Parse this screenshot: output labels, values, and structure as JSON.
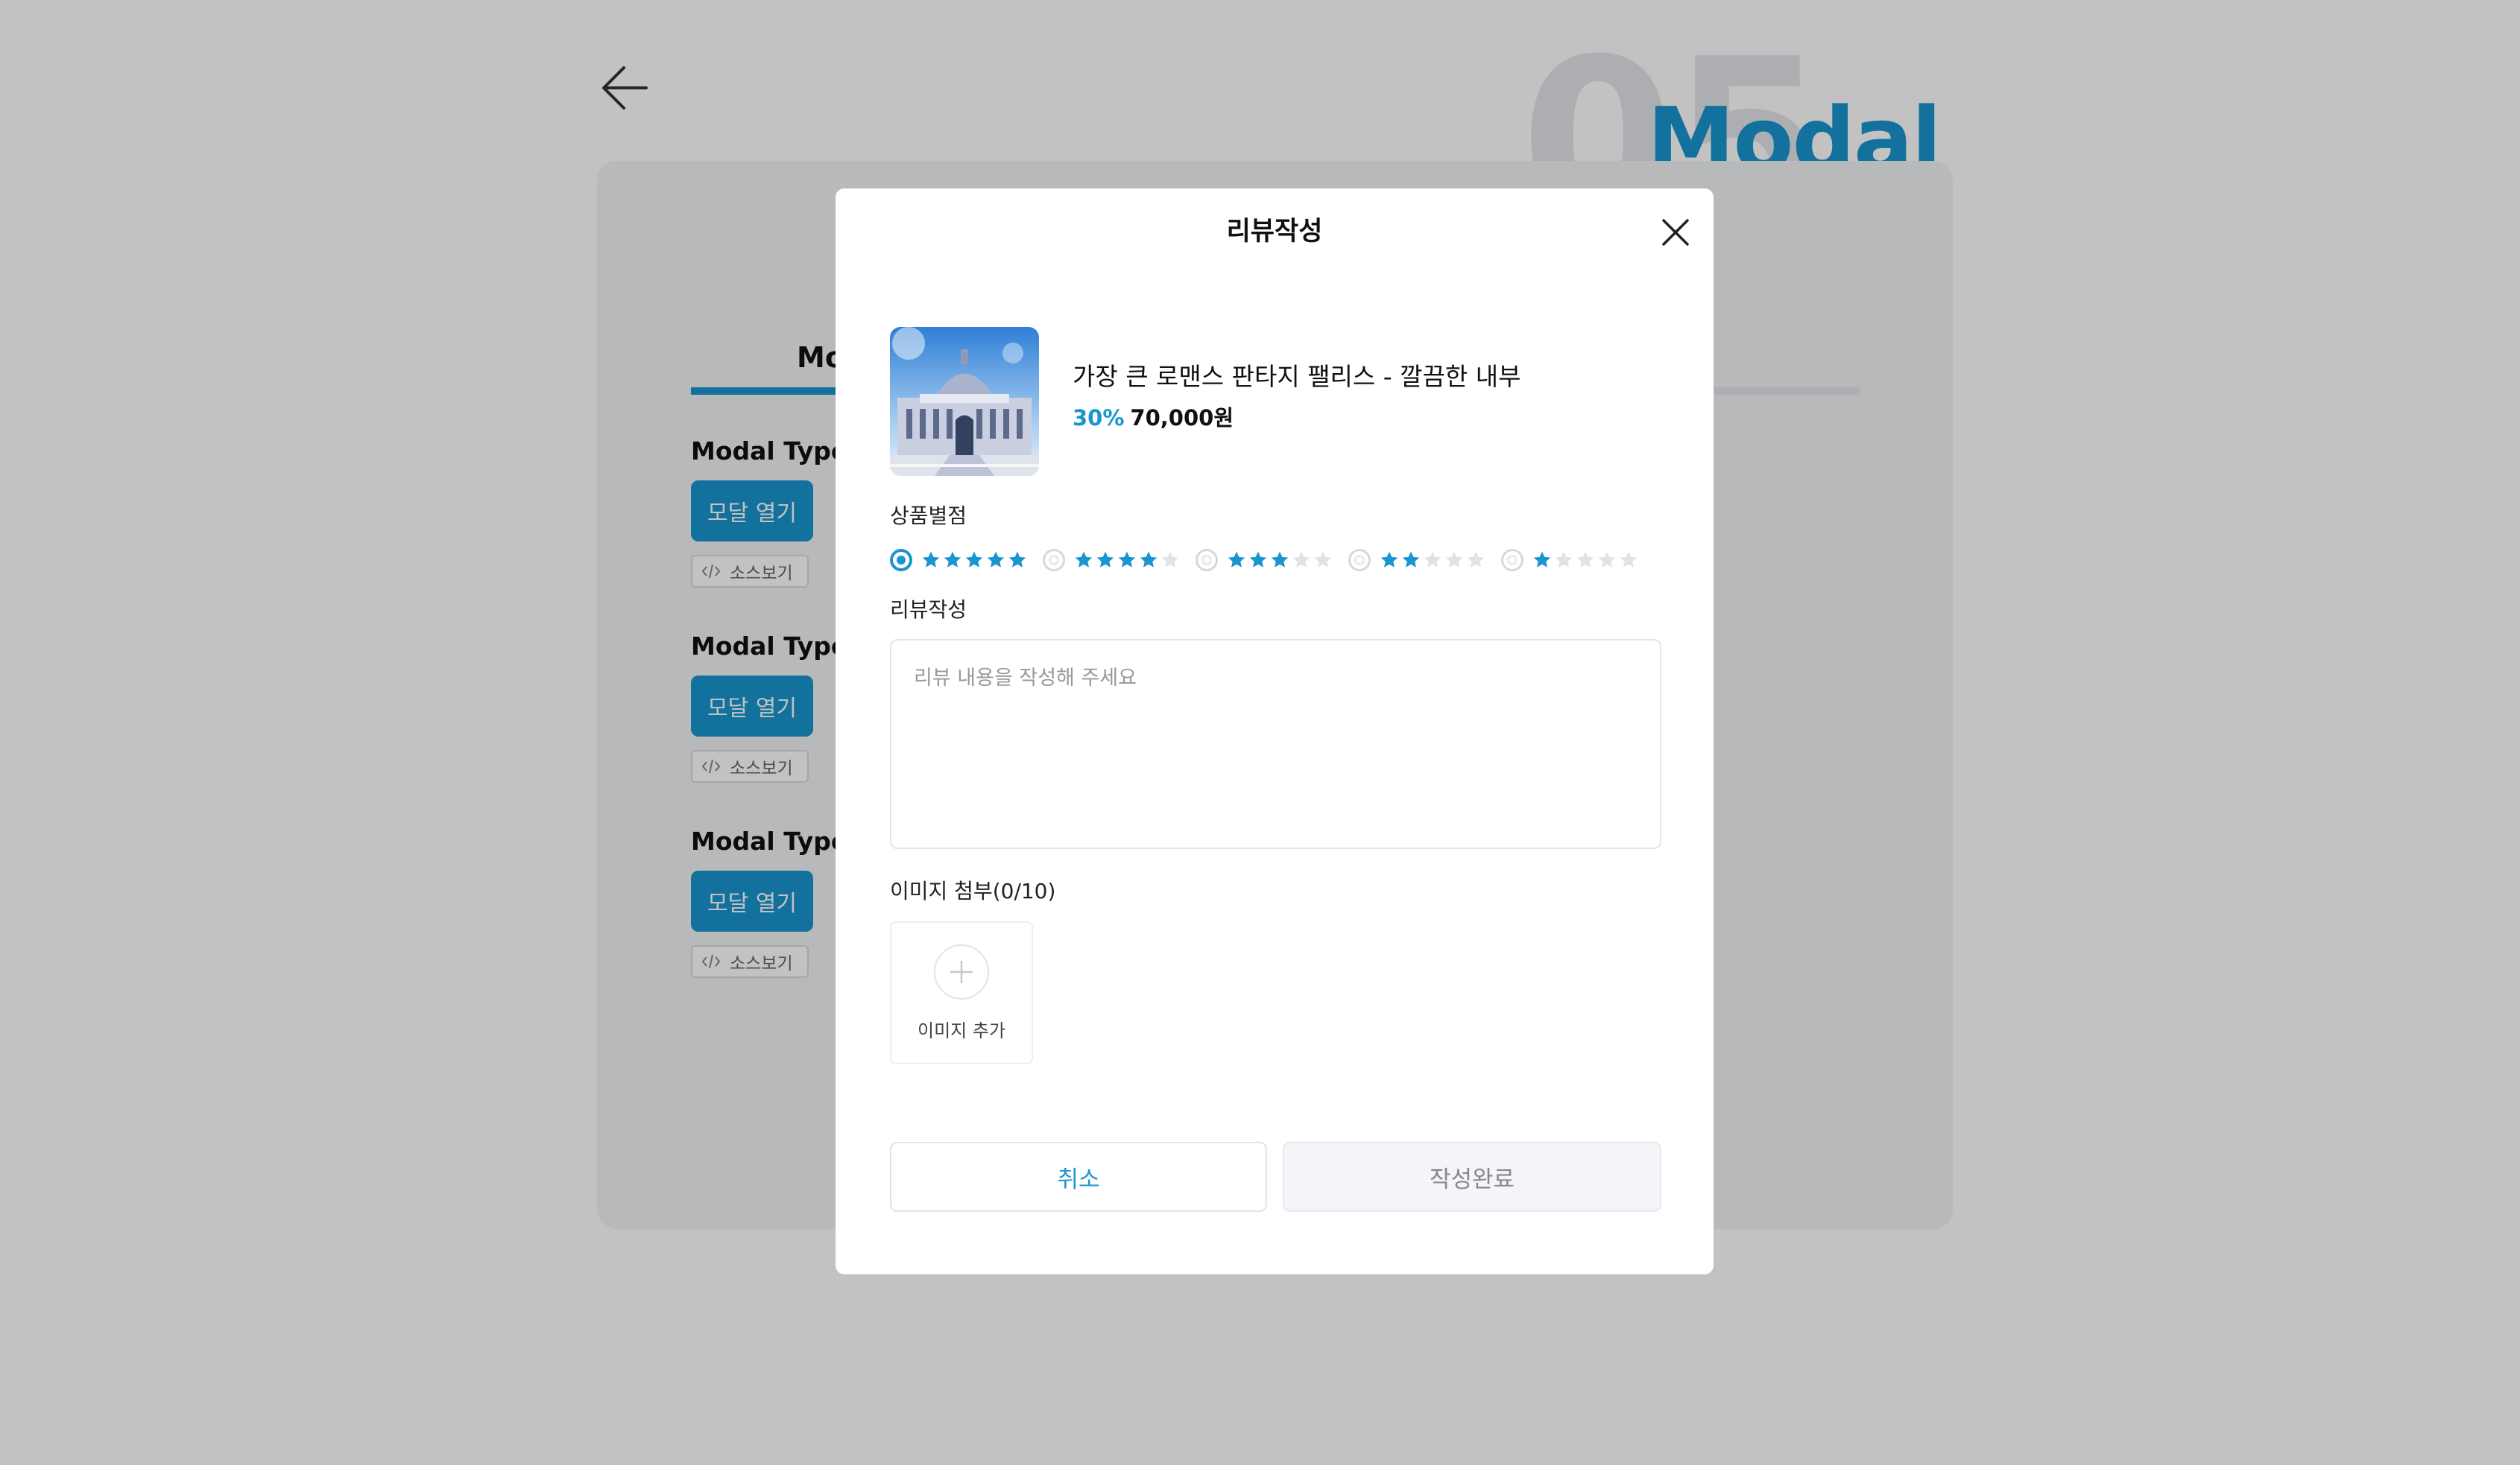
{
  "page": {
    "number": "05",
    "title": "Modal",
    "tab_active": "Mo"
  },
  "sections": [
    {
      "title": "Modal Type A",
      "button": "모달 열기",
      "source": "소스보기"
    },
    {
      "title": "Modal Type B",
      "button": "모달 열기",
      "source": "소스보기"
    },
    {
      "title": "Modal Type C",
      "button": "모달 열기",
      "source": "소스보기"
    }
  ],
  "modal": {
    "title": "리뷰작성",
    "product": {
      "name": "가장 큰 로맨스 판타지 팰리스 - 깔끔한 내부",
      "discount": "30%",
      "price": "70,000원"
    },
    "rating_label": "상품별점",
    "rating_options": [
      5,
      4,
      3,
      2,
      1
    ],
    "rating_selected": 5,
    "review_label": "리뷰작성",
    "review_placeholder": "리뷰 내용을 작성해 주세요",
    "review_value": "",
    "image_label": "이미지 첨부(0/10)",
    "add_image_label": "이미지 추가",
    "cancel_label": "취소",
    "submit_label": "작성완료"
  },
  "colors": {
    "accent": "#1a95cf",
    "star_empty": "#dfe2e7"
  },
  "icons": {
    "back": "arrow-left-icon",
    "close": "close-icon",
    "code": "code-icon",
    "star": "star-icon",
    "plus": "plus-icon"
  }
}
